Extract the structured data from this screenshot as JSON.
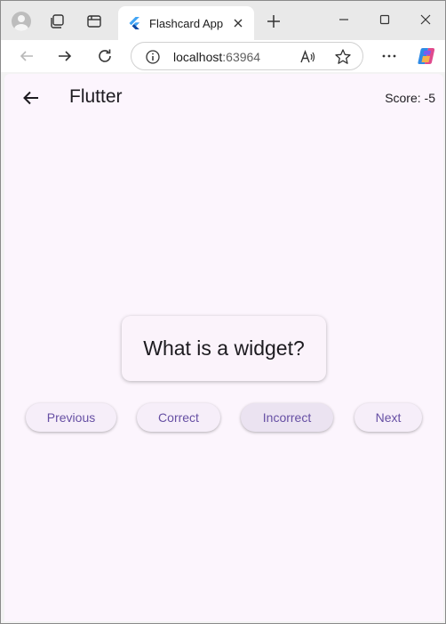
{
  "browser": {
    "tab_title": "Flashcard App",
    "url_host": "localhost",
    "url_port": ":63964"
  },
  "app": {
    "title": "Flutter",
    "score": "Score: -5",
    "question": "What is a widget?",
    "buttons": {
      "previous": "Previous",
      "correct": "Correct",
      "incorrect": "Incorrect",
      "next": "Next"
    },
    "colors": {
      "background": "#fcf5fd",
      "accent": "#6750a4"
    }
  }
}
